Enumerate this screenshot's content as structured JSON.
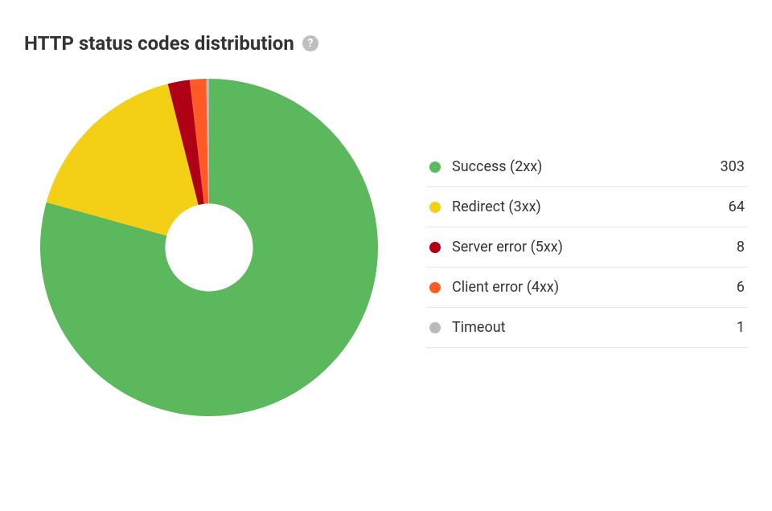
{
  "title": "HTTP status codes distribution",
  "help_icon_glyph": "?",
  "chart_data": {
    "type": "pie",
    "title": "HTTP status codes distribution",
    "donut_inner_ratio": 0.26,
    "series": [
      {
        "name": "Success (2xx)",
        "value": 303,
        "color": "#5cb85c"
      },
      {
        "name": "Redirect (3xx)",
        "value": 64,
        "color": "#f3cf16"
      },
      {
        "name": "Server error (5xx)",
        "value": 8,
        "color": "#b00015"
      },
      {
        "name": "Client error (4xx)",
        "value": 6,
        "color": "#ff5a26"
      },
      {
        "name": "Timeout",
        "value": 1,
        "color": "#b9b9b9"
      }
    ]
  }
}
